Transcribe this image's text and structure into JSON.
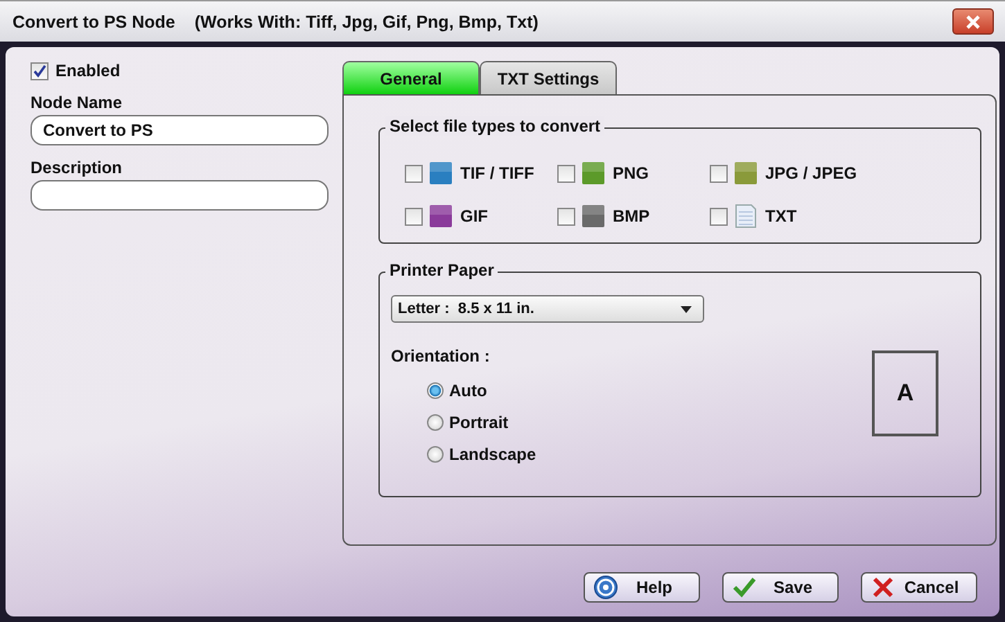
{
  "window": {
    "title": "Convert to PS Node",
    "subtitle": "(Works With: Tiff, Jpg, Gif, Png, Bmp, Txt)"
  },
  "enabled": {
    "label": "Enabled",
    "checked": true
  },
  "fields": [
    {
      "label": "Node Name",
      "value": "Convert to PS"
    },
    {
      "label": "Description"
    }
  ],
  "tabs": [
    {
      "label": "General",
      "selected": true
    },
    {
      "label": "TXT Settings",
      "selected": false
    }
  ],
  "file_types": {
    "title": "Select file types to convert",
    "items": [
      {
        "label": "TIF / TIFF",
        "checked": false,
        "kind": "badge",
        "color": "#2a7fc0"
      },
      {
        "label": "PNG",
        "checked": false,
        "kind": "badge",
        "color": "#5c9a2a"
      },
      {
        "label": "JPG / JPEG",
        "checked": false,
        "kind": "badge",
        "color": "#8a9a3a"
      },
      {
        "label": "GIF",
        "checked": false,
        "kind": "badge",
        "color": "#8a3a9a"
      },
      {
        "label": "BMP",
        "checked": false,
        "kind": "badge",
        "color": "#6a6a6a"
      },
      {
        "label": "TXT",
        "checked": false,
        "kind": "document",
        "color": "#e8eef8"
      }
    ]
  },
  "printer_paper": {
    "title": "Printer Paper",
    "paper": "Letter :  8.5 x 11 in.",
    "orientation_label": "Orientation :",
    "orientations": [
      {
        "label": "Auto",
        "selected": true
      },
      {
        "label": "Portrait",
        "selected": false
      },
      {
        "label": "Landscape",
        "selected": false
      }
    ],
    "preview": "A"
  },
  "buttons": [
    {
      "label": "Help",
      "kind": "help"
    },
    {
      "label": "Save",
      "kind": "save"
    },
    {
      "label": "Cancel",
      "kind": "cancel"
    }
  ]
}
